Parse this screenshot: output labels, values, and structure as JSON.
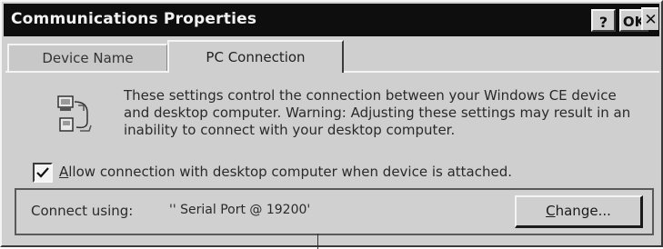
{
  "window": {
    "title": "Communications Properties",
    "help_label": "?",
    "ok_label": "OK",
    "close_label": "✕"
  },
  "tabs": [
    {
      "label": "Device Name",
      "active": false
    },
    {
      "label": "PC Connection",
      "active": true
    }
  ],
  "content": {
    "description": "These settings control the connection between your Windows CE device and desktop computer.  Warning: Adjusting these settings may result in an inability to connect with your desktop computer.",
    "icon": "pc-connection-icon",
    "allow_connection": {
      "label": "Allow connection with desktop computer when device is attached.",
      "checked": true
    },
    "connect_using": {
      "label": "Connect using:",
      "value": "'' Serial Port @ 19200'"
    },
    "change_button": "Change..."
  },
  "colors": {
    "titlebar_bg": "#0e0e0e",
    "titlebar_text": "#f2f2f2",
    "window_bg": "#cfcfcf"
  }
}
